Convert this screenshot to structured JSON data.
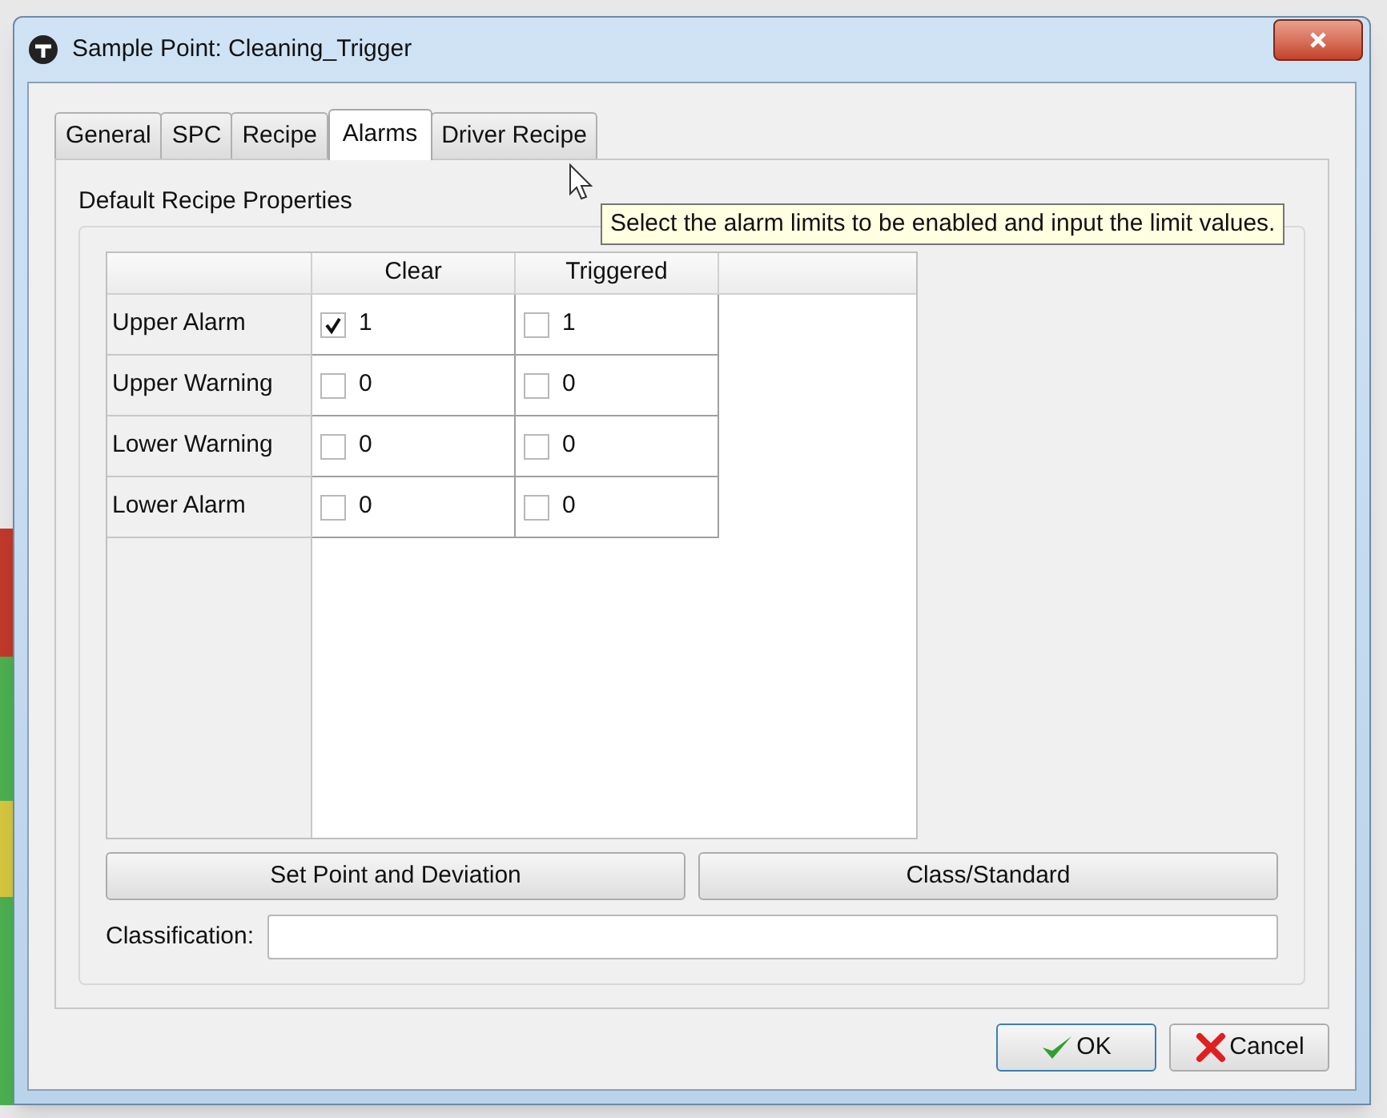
{
  "window": {
    "title": "Sample Point: Cleaning_Trigger"
  },
  "tabs": [
    {
      "label": "General",
      "selected": false
    },
    {
      "label": "SPC",
      "selected": false
    },
    {
      "label": "Recipe",
      "selected": false
    },
    {
      "label": "Alarms",
      "selected": true
    },
    {
      "label": "Driver Recipe",
      "selected": false
    }
  ],
  "group_label": "Default  Recipe Properties",
  "table": {
    "columns": [
      "Clear",
      "Triggered"
    ],
    "rows": [
      {
        "label": "Upper Alarm",
        "cells": [
          {
            "checked": true,
            "value": "1"
          },
          {
            "checked": false,
            "value": "1"
          }
        ]
      },
      {
        "label": "Upper Warning",
        "cells": [
          {
            "checked": false,
            "value": "0"
          },
          {
            "checked": false,
            "value": "0"
          }
        ]
      },
      {
        "label": "Lower Warning",
        "cells": [
          {
            "checked": false,
            "value": "0"
          },
          {
            "checked": false,
            "value": "0"
          }
        ]
      },
      {
        "label": "Lower Alarm",
        "cells": [
          {
            "checked": false,
            "value": "0"
          },
          {
            "checked": false,
            "value": "0"
          }
        ]
      }
    ]
  },
  "tooltip": "Select the alarm limits to be enabled and input the limit values.",
  "buttons": [
    "Set Point and Deviation",
    "Class/Standard"
  ],
  "classification": {
    "label": "Classification:"
  },
  "footer_buttons": [
    {
      "kind": "ok",
      "label": "OK"
    },
    {
      "kind": "cancel",
      "label": "Cancel"
    }
  ]
}
